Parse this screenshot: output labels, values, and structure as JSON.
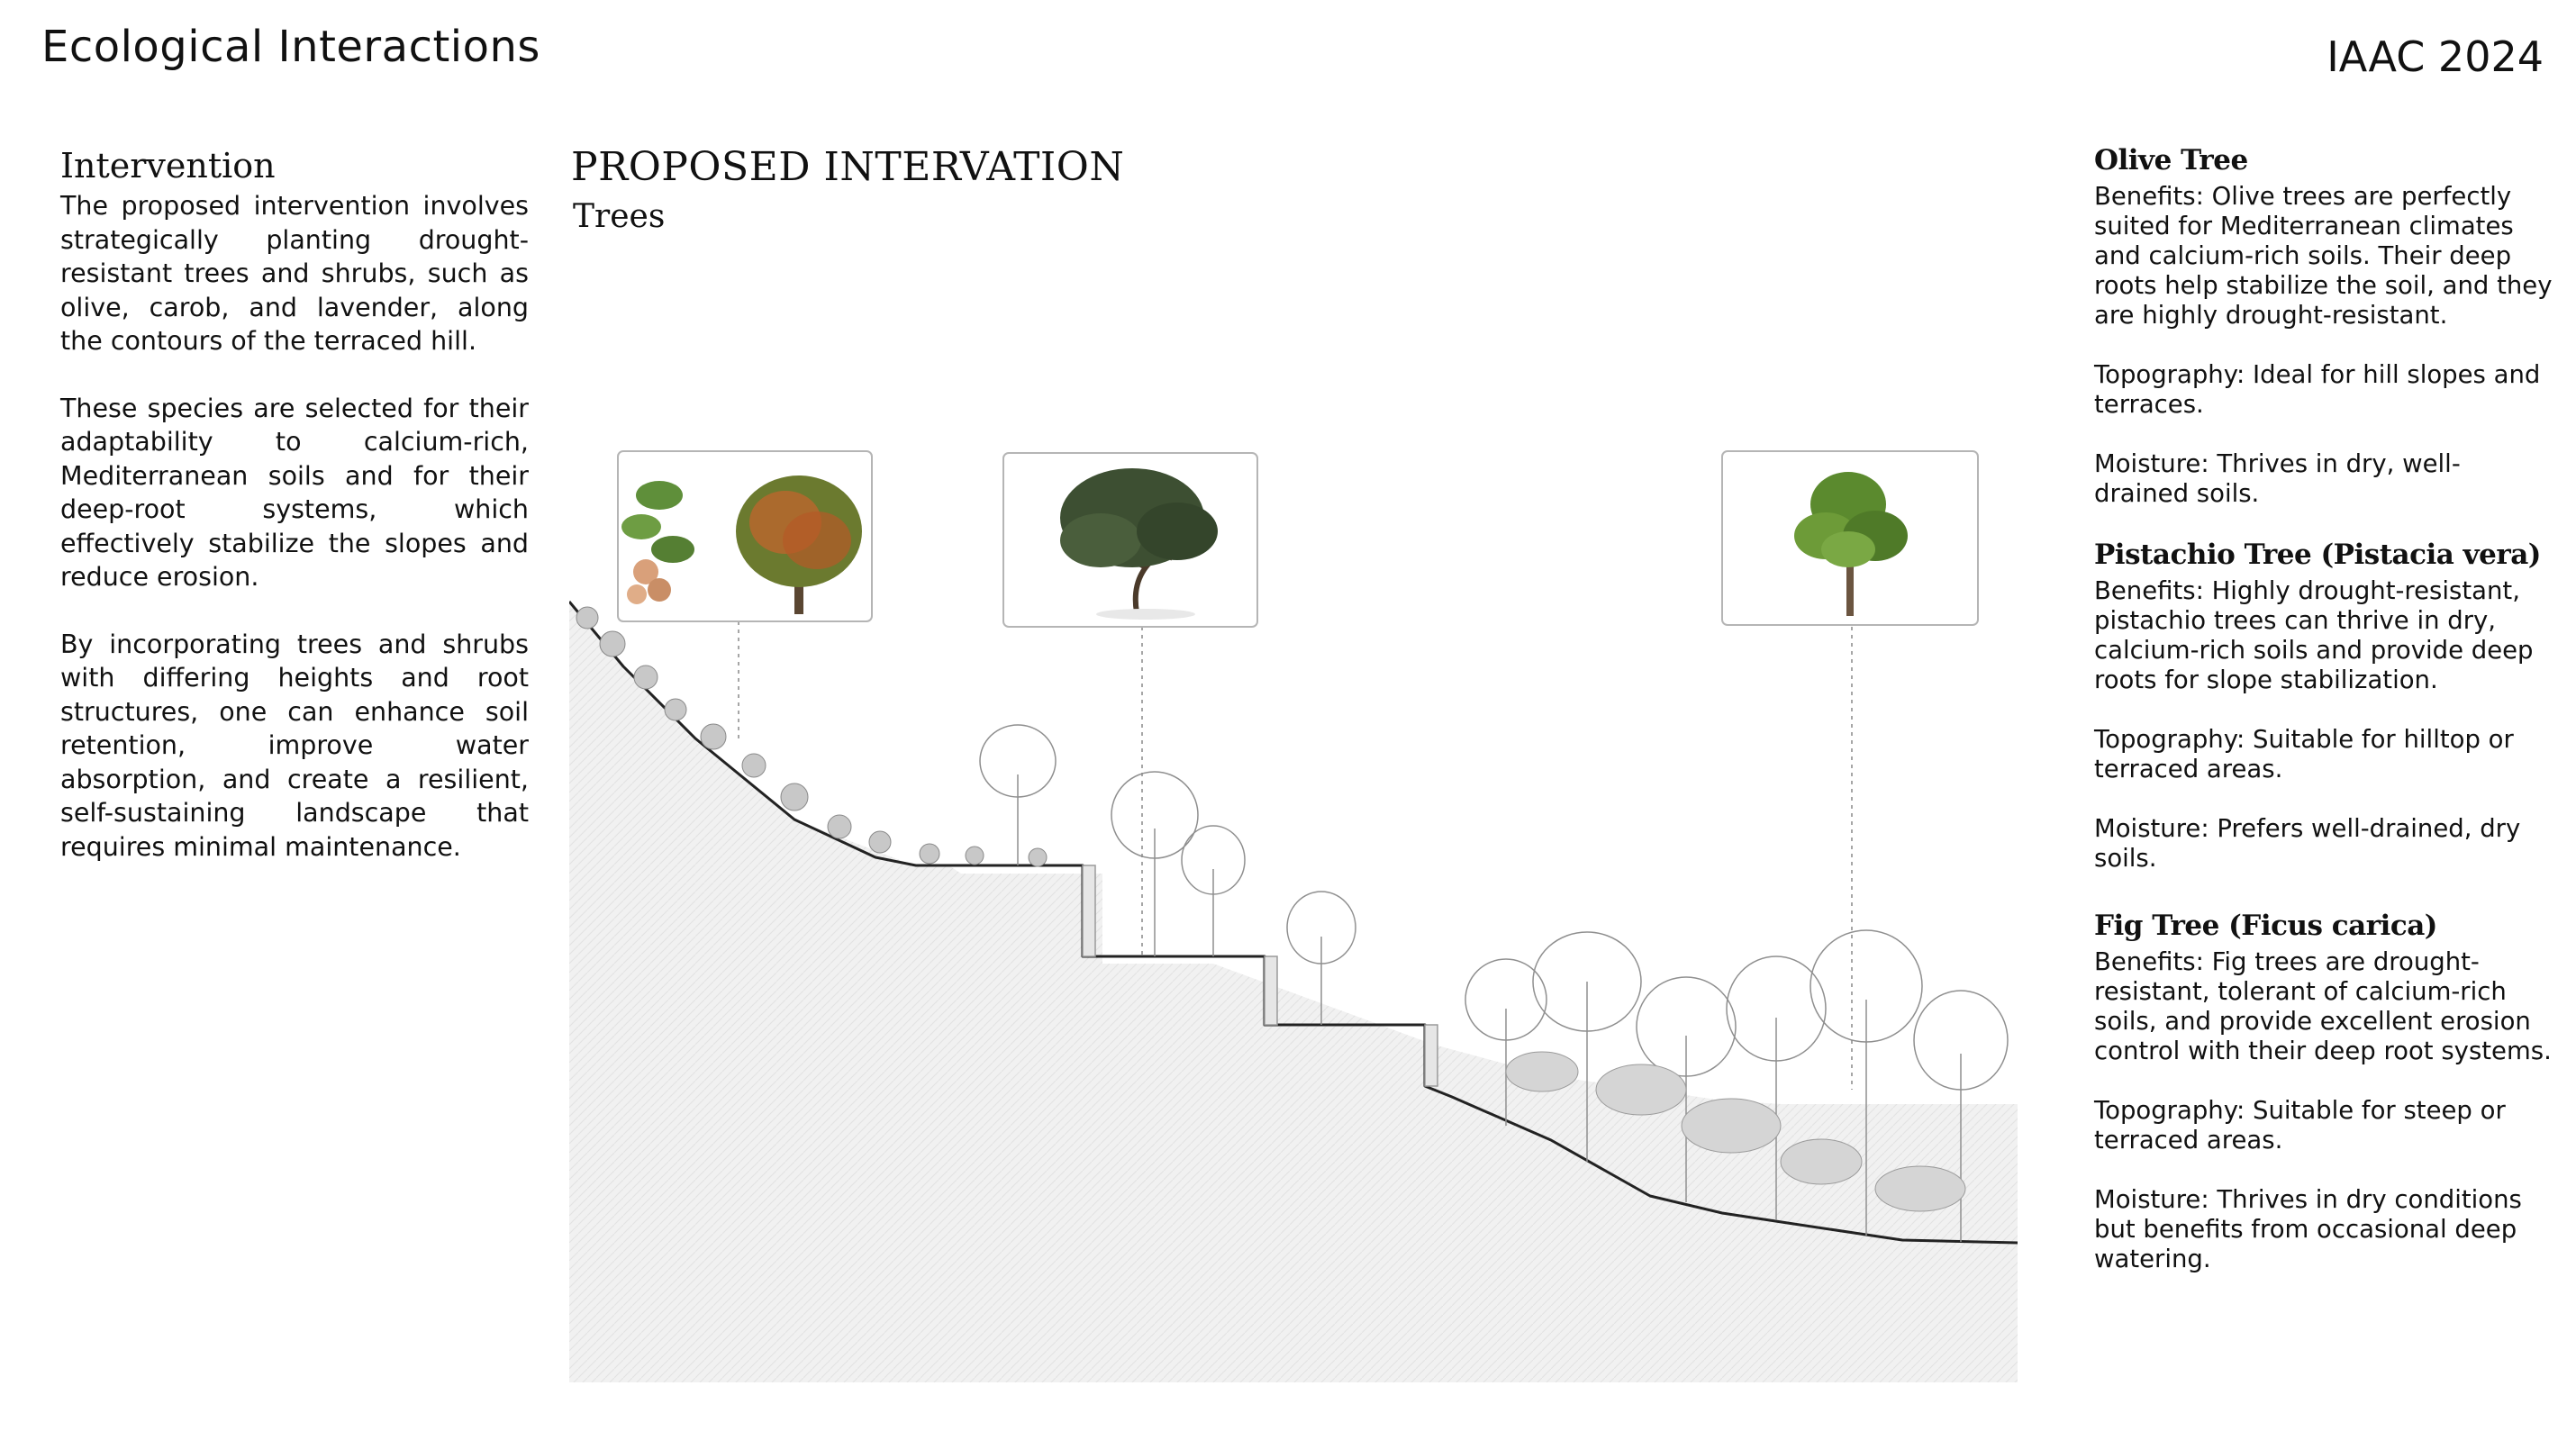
{
  "header": {
    "title": "Ecological Interactions",
    "tag": "IAAC 2024"
  },
  "left": {
    "heading": "Intervention",
    "paragraphs": [
      "The proposed intervention involves strategically planting drought-resistant trees and shrubs, such as olive, carob, and lavender, along the contours of the terraced hill.",
      "These species are selected for their adaptability to calcium-rich, Mediterranean soils and for their deep-root systems, which effectively stabilize the slopes and reduce erosion.",
      "By incorporating trees and shrubs with differing heights and root structures, one can enhance soil retention, improve water absorption, and create a resilient, self-sustaining landscape that requires minimal maintenance."
    ]
  },
  "center": {
    "title": "PROPOSED INTERVATION",
    "subtitle": "Trees"
  },
  "species": [
    {
      "name": "Olive Tree",
      "benefits": "Benefits: Olive trees are perfectly suited for Mediterranean climates and calcium-rich soils. Their deep roots help stabilize the soil, and they are highly drought-resistant.",
      "topography": "Topography: Ideal for hill slopes and terraces.",
      "moisture": "Moisture: Thrives in dry, well-drained soils."
    },
    {
      "name": "Pistachio Tree (Pistacia vera)",
      "benefits": "Benefits: Highly drought-resistant, pistachio trees can thrive in dry, calcium-rich soils and provide deep roots for slope stabilization.",
      "topography": "Topography: Suitable for hilltop or terraced areas.",
      "moisture": "Moisture: Prefers well-drained, dry soils."
    },
    {
      "name": "Fig Tree (Ficus carica)",
      "benefits": "Benefits: Fig trees are drought-resistant, tolerant of calcium-rich soils, and provide excellent erosion control with their deep root systems.",
      "topography": "Topography: Suitable for steep or terraced areas.",
      "moisture": "Moisture: Thrives in dry conditions but benefits from occasional deep watering."
    }
  ],
  "colors": {
    "ground_fill": "#eeeeee",
    "ground_line": "#222222",
    "vegetation": "#9a9a9a",
    "leader_line": "#888888",
    "card_border": "#b5b5b5"
  }
}
